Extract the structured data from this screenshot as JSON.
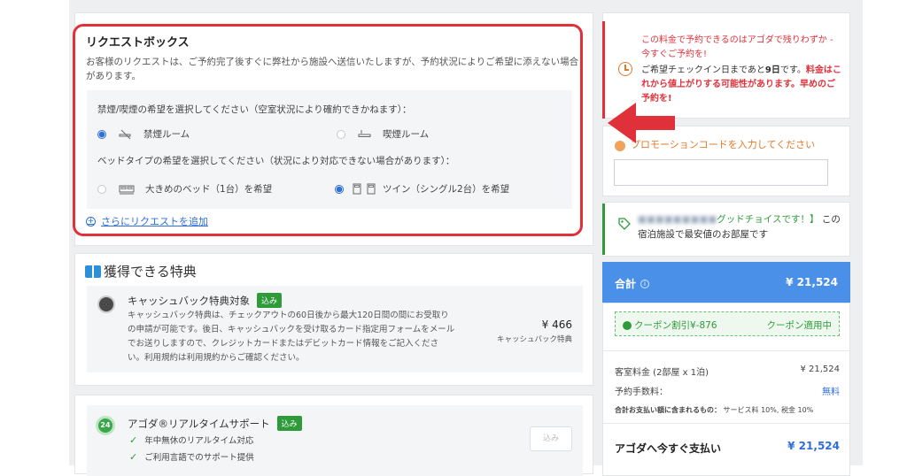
{
  "request_box": {
    "title": "リクエストボックス",
    "description": "お客様のリクエストは、ご予約完了後すぐに弊社から施設へ送信いたしますが、予約状況によりご希望に添えない場合があります。",
    "smoking_question": "禁煙/喫煙の希望を選択してください（空室状況により確約できかねます）：",
    "smoking_options": [
      {
        "label": "禁煙ルーム",
        "selected": true,
        "icon": "no-smoking-icon"
      },
      {
        "label": "喫煙ルーム",
        "selected": false,
        "icon": "smoking-icon"
      }
    ],
    "bed_question": "ベッドタイプの希望を選択してください（状況により対応できない場合があります）：",
    "bed_options": [
      {
        "label": "大きめのベッド（1台）を希望",
        "selected": false,
        "icon": "double-bed-icon"
      },
      {
        "label": "ツイン（シングル2台）を希望",
        "selected": true,
        "icon": "twin-bed-icon"
      }
    ],
    "add_request_link": "さらにリクエストを追加"
  },
  "benefits": {
    "title": "獲得できる特典",
    "cashback": {
      "title": "キャッシュバック特典対象",
      "badge": "込み",
      "description": "キャッシュバック特典は、チェックアウトの60日後から最大120日間の間にお受取りの申請が可能です。後日、キャッシュバックを受け取るカード指定用フォームをメールでお送りしますので、クレジットカードまたはデビットカード情報をご記入ください。利用規約は利用規約からご確認ください。",
      "amount": "¥ 466",
      "amount_label": "キャッシュバック特典"
    }
  },
  "support": {
    "title": "アゴダ®リアルタイムサポート",
    "badge": "込み",
    "icon_text": "24",
    "items": [
      "年中無休のリアルタイム対応",
      "ご利用言語でのサポート提供"
    ],
    "button": "込み"
  },
  "warning": {
    "line1": "この料金で予約できるのはアゴダで残りわずか - 今すぐご予約を!",
    "line2_prefix": "ご希望チェックイン日まであと",
    "line2_days": "9日",
    "line2_mid": "です。",
    "line2_emphasis": "料金はこれから値上がりする可能性があります。早めのご予約を!"
  },
  "promo": {
    "label": "プロモーションコードを入力してください",
    "value": ""
  },
  "deal": {
    "blurred": "■■■■■■■■■",
    "highlight": "グッドチョイスです！】",
    "rest": "この宿泊施設で最安値のお部屋です"
  },
  "summary": {
    "total_label": "合計",
    "total_value": "¥ 21,524",
    "coupon_left": "クーポン割引¥-876",
    "coupon_right": "クーポン適用中",
    "room_label": "客室料金 (2部屋 x 1泊)",
    "room_value": "¥ 21,524",
    "fee_label": "予約手数料：",
    "fee_value": "無料",
    "included_label": "合計お支払い額に含まれるもの：",
    "included_value": "サービス料 10%, 税金 10%",
    "pay_label": "アゴダへ今すぐ支払い",
    "pay_value": "¥ 21,524"
  },
  "colors": {
    "highlight_outline": "#e0313b",
    "arrow": "#e0313b",
    "accent_blue": "#4a8fe8",
    "success_green": "#2e9a3a"
  }
}
